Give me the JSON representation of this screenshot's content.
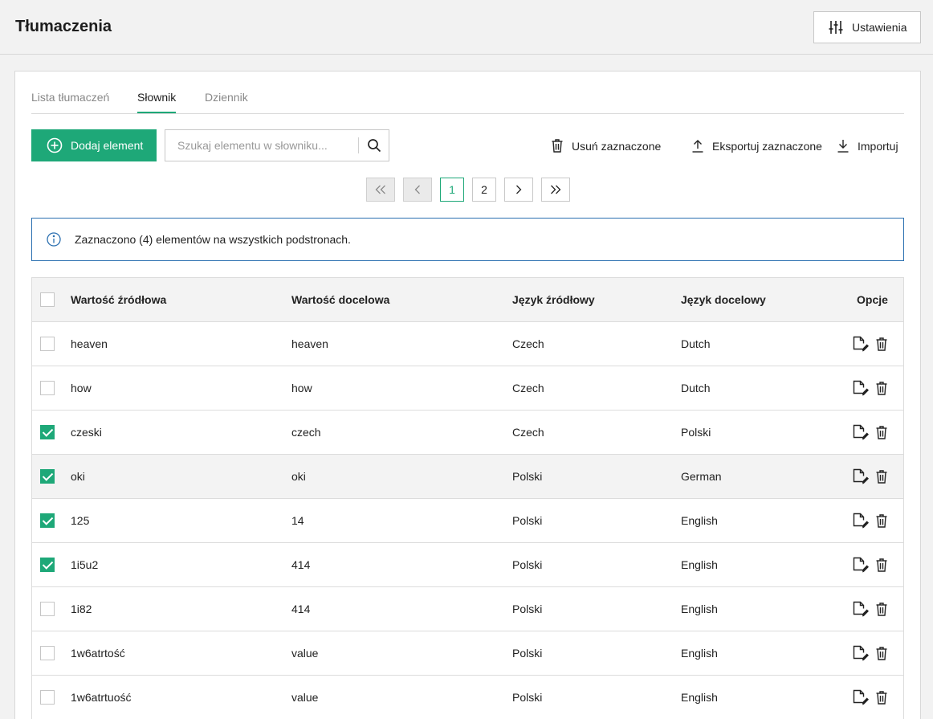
{
  "header": {
    "title": "Tłumaczenia",
    "settings_label": "Ustawienia"
  },
  "tabs": [
    {
      "label": "Lista tłumaczeń",
      "active": false
    },
    {
      "label": "Słownik",
      "active": true
    },
    {
      "label": "Dziennik",
      "active": false
    }
  ],
  "toolbar": {
    "add_label": "Dodaj element",
    "search_placeholder": "Szukaj elementu w słowniku...",
    "delete_label": "Usuń zaznaczone",
    "export_label": "Eksportuj zaznaczone",
    "import_label": "Importuj"
  },
  "pagination": {
    "pages": [
      "1",
      "2"
    ],
    "current": "1"
  },
  "info": {
    "message": "Zaznaczono (4) elementów na wszystkich podstronach."
  },
  "table": {
    "columns": [
      "Wartość źródłowa",
      "Wartość docelowa",
      "Język źródłowy",
      "Język docelowy",
      "Opcje"
    ],
    "rows": [
      {
        "source": "heaven",
        "target": "heaven",
        "source_lang": "Czech",
        "target_lang": "Dutch",
        "checked": false
      },
      {
        "source": "how",
        "target": "how",
        "source_lang": "Czech",
        "target_lang": "Dutch",
        "checked": false
      },
      {
        "source": "czeski",
        "target": "czech",
        "source_lang": "Czech",
        "target_lang": "Polski",
        "checked": true
      },
      {
        "source": "oki",
        "target": "oki",
        "source_lang": "Polski",
        "target_lang": "German",
        "checked": true
      },
      {
        "source": "125",
        "target": "14",
        "source_lang": "Polski",
        "target_lang": "English",
        "checked": true
      },
      {
        "source": "1i5u2",
        "target": "414",
        "source_lang": "Polski",
        "target_lang": "English",
        "checked": true
      },
      {
        "source": "1i82",
        "target": "414",
        "source_lang": "Polski",
        "target_lang": "English",
        "checked": false
      },
      {
        "source": "1w6atrtość",
        "target": "value",
        "source_lang": "Polski",
        "target_lang": "English",
        "checked": false
      },
      {
        "source": "1w6atrtuość",
        "target": "value",
        "source_lang": "Polski",
        "target_lang": "English",
        "checked": false
      }
    ]
  },
  "colors": {
    "accent": "#1ea878",
    "info_border": "#2a6fb0",
    "info_icon": "#2a6fb0"
  },
  "icons": [
    "sliders-icon",
    "plus-circle-icon",
    "search-icon",
    "trash-icon",
    "upload-icon",
    "download-icon",
    "first-page-icon",
    "prev-page-icon",
    "next-page-icon",
    "last-page-icon",
    "info-icon",
    "edit-icon"
  ]
}
